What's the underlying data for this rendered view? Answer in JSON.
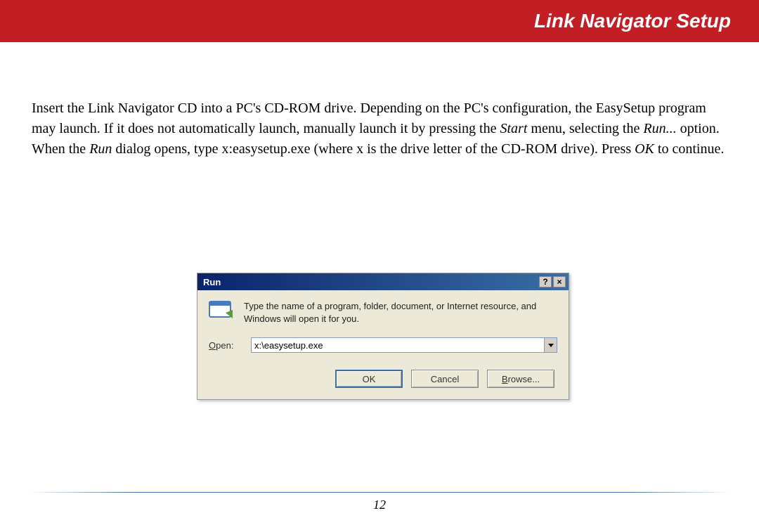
{
  "header": {
    "title": "Link Navigator Setup"
  },
  "paragraph": {
    "part1": "Insert the Link Navigator CD into a PC's CD-ROM drive.  Depending on the PC's configuration, the EasySetup program may launch.  If it does not automatically launch, manually launch it by pressing the ",
    "start": "Start",
    "part2": " menu, selecting the ",
    "run": "Run...",
    "part3": " option.  When the ",
    "run2": "Run",
    "part4": " dialog opens, type x:easysetup.exe (where x is the drive letter of the CD-ROM drive).  Press ",
    "ok": "OK",
    "part5": " to continue."
  },
  "dialog": {
    "title": "Run",
    "help_btn": "?",
    "close_btn": "×",
    "description": "Type the name of a program, folder, document, or Internet resource, and Windows will open it for you.",
    "open_label_u": "O",
    "open_label_rest": "pen:",
    "input_value": "x:\\easysetup.exe",
    "buttons": {
      "ok": "OK",
      "cancel": "Cancel",
      "browse_u": "B",
      "browse_rest": "rowse..."
    }
  },
  "page_number": "12"
}
